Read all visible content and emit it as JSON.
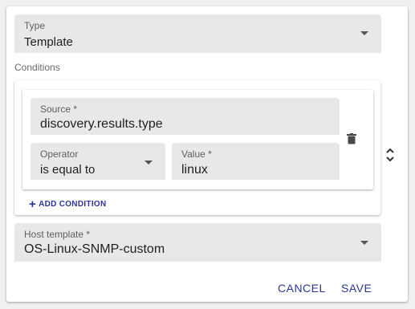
{
  "type_field": {
    "label": "Type",
    "value": "Template"
  },
  "conditions": {
    "section_label": "Conditions",
    "source": {
      "label": "Source *",
      "value": "discovery.results.type"
    },
    "operator": {
      "label": "Operator",
      "value": "is equal to"
    },
    "value": {
      "label": "Value *",
      "value": "linux"
    },
    "add_label": "ADD CONDITION"
  },
  "host_template": {
    "label": "Host template *",
    "value": "OS-Linux-SNMP-custom"
  },
  "actions": {
    "cancel": "CANCEL",
    "save": "SAVE"
  },
  "colors": {
    "accent": "#2c3596",
    "field_bg": "#e8e8e8"
  }
}
